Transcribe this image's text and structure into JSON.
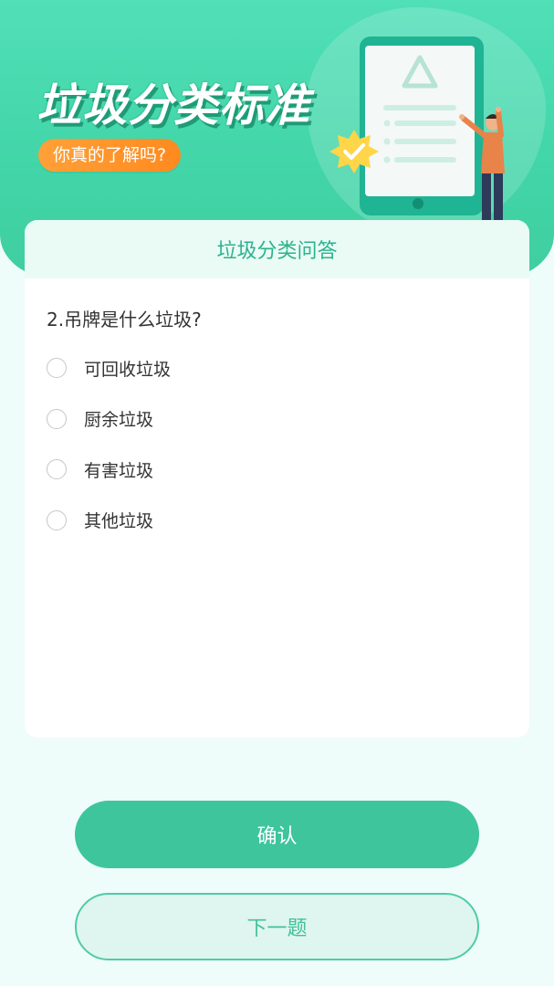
{
  "banner": {
    "title": "垃圾分类标准",
    "subtitle": "你真的了解吗?"
  },
  "quiz": {
    "header": "垃圾分类问答",
    "question": "2.吊牌是什么垃圾?",
    "options": [
      {
        "label": "可回收垃圾"
      },
      {
        "label": "厨余垃圾"
      },
      {
        "label": "有害垃圾"
      },
      {
        "label": "其他垃圾"
      }
    ]
  },
  "buttons": {
    "confirm_label": "确认",
    "next_label": "下一题"
  },
  "icons": {
    "recycle": "recycle-icon",
    "badge": "check-badge-icon"
  },
  "colors": {
    "primary": "#3ec59b",
    "banner": "#43d6a9",
    "accent_orange": "#ff9a2e",
    "card_header_text": "#2ab38a"
  }
}
